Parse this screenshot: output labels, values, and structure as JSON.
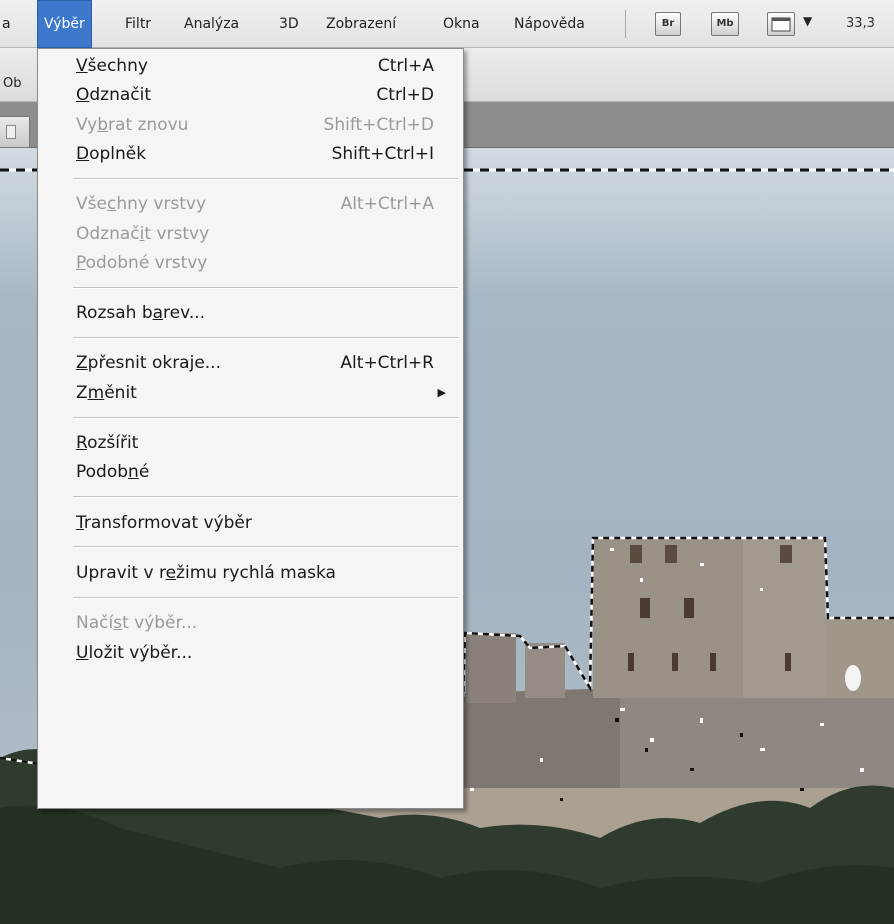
{
  "menubar": {
    "items": [
      {
        "label": "a"
      },
      {
        "label": "Výběr",
        "active": true
      },
      {
        "label": "Filtr"
      },
      {
        "label": "Analýza"
      },
      {
        "label": "3D"
      },
      {
        "label": "Zobrazení"
      },
      {
        "label": "Okna"
      },
      {
        "label": "Nápověda"
      }
    ],
    "bridge_label": "Br",
    "minibridge_label": "Mb",
    "dropdown_glyph": "▼",
    "zoom": "33,3"
  },
  "options_bar": {
    "truncated_label": "Ob"
  },
  "accent_color": "#3d78cc",
  "selection_menu": {
    "sections": [
      {
        "items": [
          {
            "pre": "",
            "ul": "V",
            "post": "šechny",
            "shortcut": "Ctrl+A",
            "disabled": false
          },
          {
            "pre": "",
            "ul": "O",
            "post": "dznačit",
            "shortcut": "Ctrl+D",
            "disabled": false
          },
          {
            "pre": "Vy",
            "ul": "b",
            "post": "rat znovu",
            "shortcut": "Shift+Ctrl+D",
            "disabled": true
          },
          {
            "pre": "",
            "ul": "D",
            "post": "oplněk",
            "shortcut": "Shift+Ctrl+I",
            "disabled": false
          }
        ]
      },
      {
        "items": [
          {
            "pre": "Vše",
            "ul": "c",
            "post": "hny vrstvy",
            "shortcut": "Alt+Ctrl+A",
            "disabled": true
          },
          {
            "pre": "Odznač",
            "ul": "i",
            "post": "t vrstvy",
            "shortcut": "",
            "disabled": true
          },
          {
            "pre": "",
            "ul": "P",
            "post": "odobné vrstvy",
            "shortcut": "",
            "disabled": true
          }
        ]
      },
      {
        "items": [
          {
            "pre": "Rozsah b",
            "ul": "a",
            "post": "rev...",
            "shortcut": "",
            "disabled": false
          }
        ]
      },
      {
        "items": [
          {
            "pre": "",
            "ul": "Z",
            "post": "přesnit okraje...",
            "shortcut": "Alt+Ctrl+R",
            "disabled": false
          },
          {
            "pre": "Z",
            "ul": "m",
            "post": "ěnit",
            "shortcut": "",
            "disabled": false,
            "submenu": true
          }
        ]
      },
      {
        "items": [
          {
            "pre": "",
            "ul": "R",
            "post": "ozšířit",
            "shortcut": "",
            "disabled": false
          },
          {
            "pre": "Podob",
            "ul": "n",
            "post": "é",
            "shortcut": "",
            "disabled": false
          }
        ]
      },
      {
        "items": [
          {
            "pre": "",
            "ul": "T",
            "post": "ransformovat výběr",
            "shortcut": "",
            "disabled": false
          }
        ]
      },
      {
        "items": [
          {
            "pre": "Upravit v r",
            "ul": "e",
            "post": "žimu rychlá maska",
            "shortcut": "",
            "disabled": false
          }
        ]
      },
      {
        "items": [
          {
            "pre": "Načí",
            "ul": "s",
            "post": "t výběr...",
            "shortcut": "",
            "disabled": true
          },
          {
            "pre": "",
            "ul": "U",
            "post": "ložit výběr...",
            "shortcut": "",
            "disabled": false
          }
        ]
      }
    ]
  }
}
